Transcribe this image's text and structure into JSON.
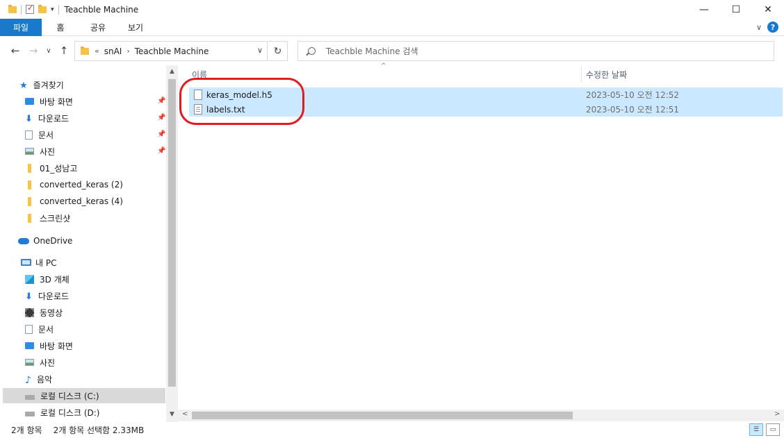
{
  "window": {
    "title": "Teachble Machine",
    "controls": [
      "—",
      "☐",
      "✕"
    ]
  },
  "ribbon": {
    "tabs": [
      "파일",
      "홈",
      "공유",
      "보기"
    ],
    "help": "?"
  },
  "address": {
    "prefix": "«",
    "crumbs": [
      "snAI",
      "Teachble Machine"
    ]
  },
  "search": {
    "placeholder": "Teachble Machine 검색"
  },
  "sidebar": {
    "quick_access": "즐겨찾기",
    "quick_items": [
      "바탕 화면",
      "다운로드",
      "문서",
      "사진",
      "01_성남고",
      "converted_keras (2)",
      "converted_keras (4)",
      "스크린샷"
    ],
    "onedrive": "OneDrive",
    "this_pc": "내 PC",
    "pc_items": [
      "3D 개체",
      "다운로드",
      "동영상",
      "문서",
      "바탕 화면",
      "사진",
      "음악",
      "로컬 디스크 (C:)",
      "로컬 디스크 (D:)"
    ]
  },
  "columns": {
    "name": "이름",
    "date": "수정한 날짜"
  },
  "files": [
    {
      "name": "keras_model.h5",
      "date": "2023-05-10 오전 12:52"
    },
    {
      "name": "labels.txt",
      "date": "2023-05-10 오전 12:51"
    }
  ],
  "status": {
    "count": "2개 항목",
    "selection": "2개 항목 선택함 2.33MB"
  },
  "colors": {
    "accent": "#1979ca",
    "selection": "#cce8ff",
    "annotation": "#e11b22"
  }
}
